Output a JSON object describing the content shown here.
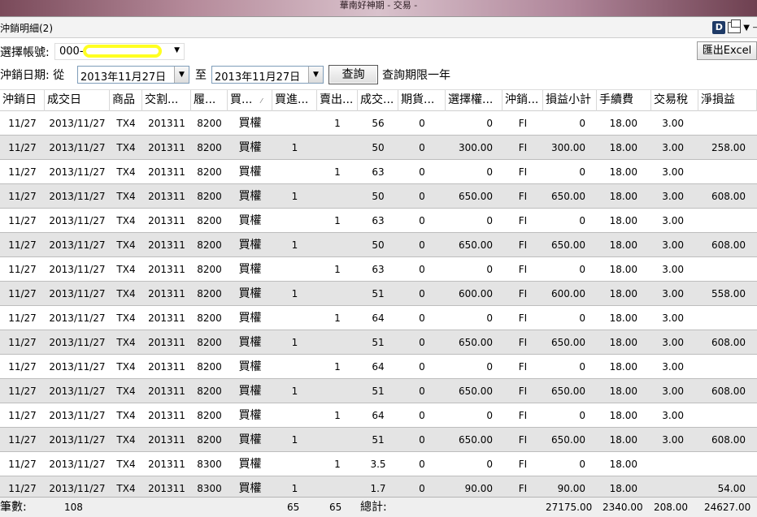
{
  "window": {
    "title": "華南好神期 - 交易 -"
  },
  "tab": {
    "title": "沖銷明細(2)"
  },
  "filters": {
    "account_label": "選擇帳號:",
    "account_value": "000-",
    "date_label": "沖銷日期: 從",
    "date_from": "2013年11月27日",
    "to_label": "至",
    "date_to": "2013年11月27日",
    "query_button": "查詢",
    "query_note": "查詢期限一年",
    "export_button": "匯出Excel"
  },
  "table": {
    "headers": [
      "沖銷日",
      "成交日",
      "商品",
      "交割...",
      "履...",
      "買...",
      "買進...",
      "賣出...",
      "成交...",
      "期貨...",
      "選擇權...",
      "沖銷...",
      "損益小計",
      "手續費",
      "交易稅",
      "淨損益"
    ],
    "rows": [
      [
        "11/27",
        "2013/11/27",
        "TX4",
        "201311",
        "8200",
        "買權",
        "",
        "1",
        "56",
        "0",
        "0",
        "FI",
        "0",
        "18.00",
        "3.00",
        ""
      ],
      [
        "11/27",
        "2013/11/27",
        "TX4",
        "201311",
        "8200",
        "買權",
        "1",
        "",
        "50",
        "0",
        "300.00",
        "FI",
        "300.00",
        "18.00",
        "3.00",
        "258.00"
      ],
      [
        "11/27",
        "2013/11/27",
        "TX4",
        "201311",
        "8200",
        "買權",
        "",
        "1",
        "63",
        "0",
        "0",
        "FI",
        "0",
        "18.00",
        "3.00",
        ""
      ],
      [
        "11/27",
        "2013/11/27",
        "TX4",
        "201311",
        "8200",
        "買權",
        "1",
        "",
        "50",
        "0",
        "650.00",
        "FI",
        "650.00",
        "18.00",
        "3.00",
        "608.00"
      ],
      [
        "11/27",
        "2013/11/27",
        "TX4",
        "201311",
        "8200",
        "買權",
        "",
        "1",
        "63",
        "0",
        "0",
        "FI",
        "0",
        "18.00",
        "3.00",
        ""
      ],
      [
        "11/27",
        "2013/11/27",
        "TX4",
        "201311",
        "8200",
        "買權",
        "1",
        "",
        "50",
        "0",
        "650.00",
        "FI",
        "650.00",
        "18.00",
        "3.00",
        "608.00"
      ],
      [
        "11/27",
        "2013/11/27",
        "TX4",
        "201311",
        "8200",
        "買權",
        "",
        "1",
        "63",
        "0",
        "0",
        "FI",
        "0",
        "18.00",
        "3.00",
        ""
      ],
      [
        "11/27",
        "2013/11/27",
        "TX4",
        "201311",
        "8200",
        "買權",
        "1",
        "",
        "51",
        "0",
        "600.00",
        "FI",
        "600.00",
        "18.00",
        "3.00",
        "558.00"
      ],
      [
        "11/27",
        "2013/11/27",
        "TX4",
        "201311",
        "8200",
        "買權",
        "",
        "1",
        "64",
        "0",
        "0",
        "FI",
        "0",
        "18.00",
        "3.00",
        ""
      ],
      [
        "11/27",
        "2013/11/27",
        "TX4",
        "201311",
        "8200",
        "買權",
        "1",
        "",
        "51",
        "0",
        "650.00",
        "FI",
        "650.00",
        "18.00",
        "3.00",
        "608.00"
      ],
      [
        "11/27",
        "2013/11/27",
        "TX4",
        "201311",
        "8200",
        "買權",
        "",
        "1",
        "64",
        "0",
        "0",
        "FI",
        "0",
        "18.00",
        "3.00",
        ""
      ],
      [
        "11/27",
        "2013/11/27",
        "TX4",
        "201311",
        "8200",
        "買權",
        "1",
        "",
        "51",
        "0",
        "650.00",
        "FI",
        "650.00",
        "18.00",
        "3.00",
        "608.00"
      ],
      [
        "11/27",
        "2013/11/27",
        "TX4",
        "201311",
        "8200",
        "買權",
        "",
        "1",
        "64",
        "0",
        "0",
        "FI",
        "0",
        "18.00",
        "3.00",
        ""
      ],
      [
        "11/27",
        "2013/11/27",
        "TX4",
        "201311",
        "8200",
        "買權",
        "1",
        "",
        "51",
        "0",
        "650.00",
        "FI",
        "650.00",
        "18.00",
        "3.00",
        "608.00"
      ],
      [
        "11/27",
        "2013/11/27",
        "TX4",
        "201311",
        "8300",
        "買權",
        "",
        "1",
        "3.5",
        "0",
        "0",
        "FI",
        "0",
        "18.00",
        "",
        ""
      ],
      [
        "11/27",
        "2013/11/27",
        "TX4",
        "201311",
        "8300",
        "買權",
        "1",
        "",
        "1.7",
        "0",
        "90.00",
        "FI",
        "90.00",
        "18.00",
        "",
        "54.00"
      ]
    ]
  },
  "footer": {
    "count_label": "筆數:",
    "count_value": "108",
    "buy_total": "65",
    "sell_total": "65",
    "total_label": "總計:",
    "pnl_total": "27175.00",
    "fee_total": "2340.00",
    "tax_total": "208.00",
    "net_total": "24627.00"
  },
  "colors": {
    "row_alt": "#e4e4e4",
    "account_mask": "#ffff22"
  }
}
